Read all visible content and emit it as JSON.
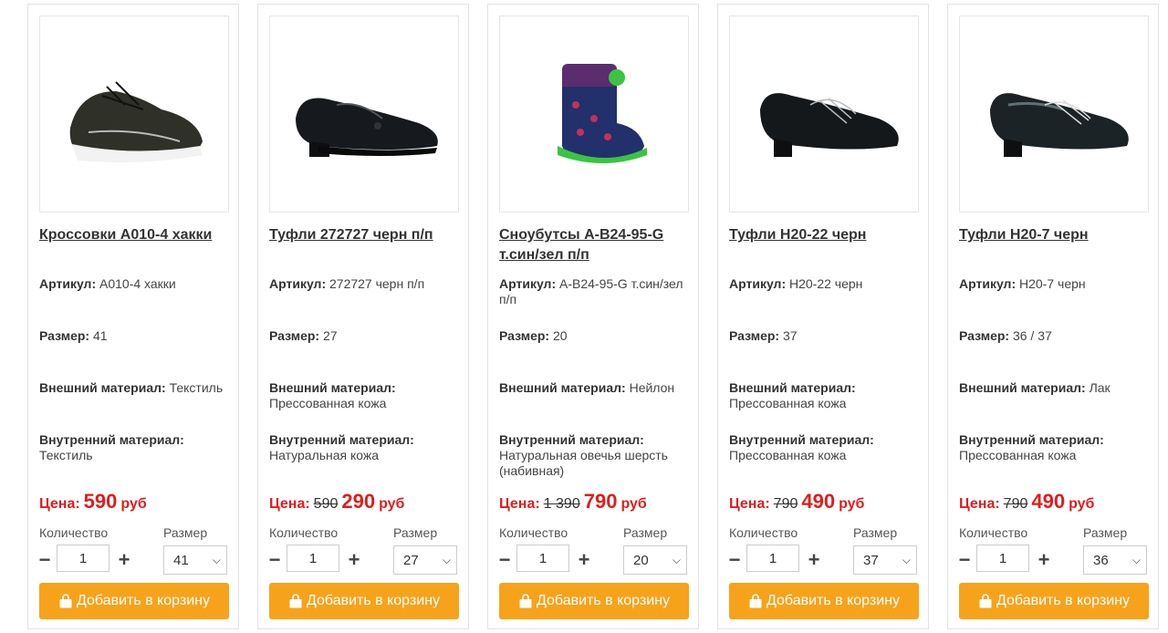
{
  "labels": {
    "article": "Артикул:",
    "size": "Размер:",
    "outer": "Внешний материал:",
    "inner": "Внутренний материал:",
    "price": "Цена:",
    "currency": "руб",
    "quantity": "Количество",
    "size_select": "Размер",
    "add_to_cart": "Добавить в корзину",
    "minus": "−",
    "plus": "+",
    "chevron": "⌄"
  },
  "colors": {
    "accent": "#f7a21b",
    "price": "#e01d1d"
  },
  "products": [
    {
      "title": "Кроссовки A010-4 хакки",
      "article": "A010-4 хакки",
      "size": "41",
      "outer": "Текстиль",
      "inner": "Текстиль",
      "old_price": "",
      "price": "590",
      "qty": "1",
      "size_selected": "41",
      "image": "sneaker-khaki"
    },
    {
      "title": "Туфли 272727 черн п/п",
      "article": "272727 черн п/п",
      "size": "27",
      "outer": "Прессованная кожа",
      "inner": "Натуральная кожа",
      "old_price": "590",
      "price": "290",
      "qty": "1",
      "size_selected": "27",
      "image": "loafer-black"
    },
    {
      "title": "Сноубутсы A-B24-95-G т.син/зел п/п",
      "article": "A-B24-95-G т.син/зел п/п",
      "size": "20",
      "outer": "Нейлон",
      "inner": "Натуральная овечья шерсть (набивная)",
      "old_price": "1 390",
      "price": "790",
      "qty": "1",
      "size_selected": "20",
      "image": "snowboot-kids"
    },
    {
      "title": "Туфли H20-22 черн",
      "article": "H20-22 черн",
      "size": "37",
      "outer": "Прессованная кожа",
      "inner": "Прессованная кожа",
      "old_price": "790",
      "price": "490",
      "qty": "1",
      "size_selected": "37",
      "image": "shoe-black-laced"
    },
    {
      "title": "Туфли H20-7 черн",
      "article": "H20-7 черн",
      "size": "36 / 37",
      "outer": "Лак",
      "inner": "Прессованная кожа",
      "old_price": "790",
      "price": "490",
      "qty": "1",
      "size_selected": "36",
      "image": "shoe-patent-laced"
    }
  ]
}
